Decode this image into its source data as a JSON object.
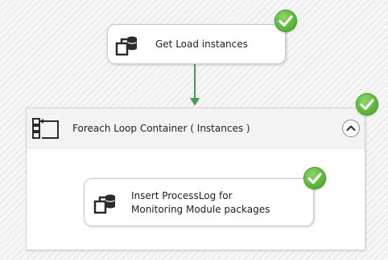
{
  "tasks": {
    "get_load": {
      "label": "Get Load instances",
      "status": "success",
      "icon": "database-task-icon"
    },
    "insert_log": {
      "label_line1": "Insert ProcessLog for",
      "label_line2": "Monitoring Module packages",
      "status": "success",
      "icon": "database-task-icon"
    }
  },
  "container": {
    "title": "Foreach Loop Container ( Instances )",
    "status": "success",
    "icon": "foreach-loop-icon",
    "collapse_icon": "chevron-up-icon"
  },
  "colors": {
    "success_green": "#5cb83a",
    "constraint_arrow": "#3fa34d"
  }
}
